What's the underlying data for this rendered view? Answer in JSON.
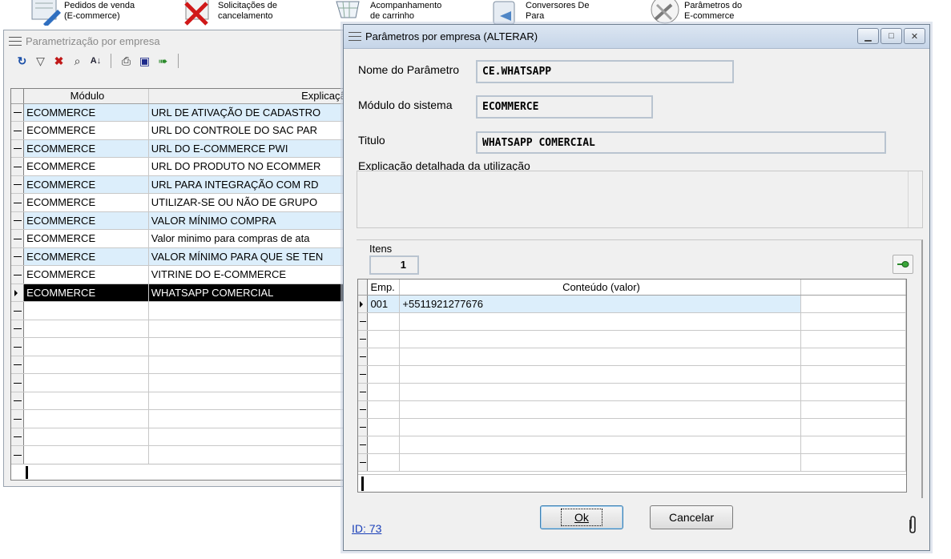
{
  "launcher": [
    {
      "label": "Pedidos de venda\n(E-commerce)",
      "icon": "sales-order-icon"
    },
    {
      "label": "Solicitações de\ncancelamento",
      "icon": "cancel-request-icon"
    },
    {
      "label": "Acompanhamento\nde carrinho",
      "icon": "cart-tracking-icon"
    },
    {
      "label": "Conversores De\nPara",
      "icon": "converter-icon"
    },
    {
      "label": "Parâmetros do\nE-commerce",
      "icon": "tools-icon"
    }
  ],
  "back_window": {
    "title": "Parametrização por empresa",
    "columns": [
      "Módulo",
      "Explicação"
    ],
    "rows": [
      {
        "modulo": "ECOMMERCE",
        "explicacao": "URL DE ATIVAÇÃO DE CADASTRO"
      },
      {
        "modulo": "ECOMMERCE",
        "explicacao": "URL DO CONTROLE DO SAC PAR"
      },
      {
        "modulo": "ECOMMERCE",
        "explicacao": "URL DO E-COMMERCE PWI"
      },
      {
        "modulo": "ECOMMERCE",
        "explicacao": "URL DO PRODUTO NO ECOMMER"
      },
      {
        "modulo": "ECOMMERCE",
        "explicacao": "URL PARA INTEGRAÇÃO COM RD"
      },
      {
        "modulo": "ECOMMERCE",
        "explicacao": "UTILIZAR-SE OU NÃO DE GRUPO"
      },
      {
        "modulo": "ECOMMERCE",
        "explicacao": "VALOR MÍNIMO COMPRA"
      },
      {
        "modulo": "ECOMMERCE",
        "explicacao": "Valor minimo para compras de ata"
      },
      {
        "modulo": "ECOMMERCE",
        "explicacao": "VALOR MÍNIMO PARA QUE SE TEN"
      },
      {
        "modulo": "ECOMMERCE",
        "explicacao": "VITRINE DO E-COMMERCE"
      },
      {
        "modulo": "ECOMMERCE",
        "explicacao": "WHATSAPP COMERCIAL"
      }
    ],
    "selected_row": 10
  },
  "dialog": {
    "title": "Parâmetros por empresa (ALTERAR)",
    "labels": {
      "nome": "Nome do Parâmetro",
      "modulo": "Módulo do sistema",
      "titulo": "Titulo",
      "explicacao": "Explicação detalhada da utilização",
      "itens": "Itens"
    },
    "values": {
      "nome": "CE.WHATSAPP",
      "modulo": "ECOMMERCE",
      "titulo": "WHATSAPP COMERCIAL",
      "explicacao": "",
      "itens": "1"
    },
    "grid": {
      "columns": [
        "Emp.",
        "Conteúdo (valor)"
      ],
      "rows": [
        {
          "emp": "001",
          "valor": "+5511921277676"
        }
      ]
    },
    "buttons": {
      "ok": "Ok",
      "cancel": "Cancelar"
    },
    "id_link": "ID: 73"
  },
  "colors": {
    "accent_row": "#dceefb",
    "selected_row": "#000000",
    "link": "#1a3fb8"
  }
}
